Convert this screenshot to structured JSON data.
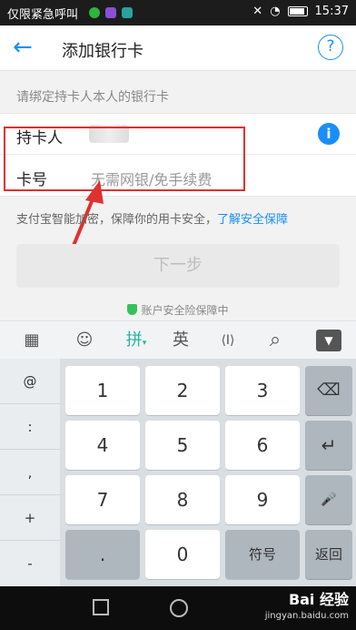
{
  "status_bar": {
    "carrier": "仅限紧急呼叫",
    "time": "15:37",
    "icons": [
      "wechat-icon",
      "app-icon",
      "app-icon",
      "mute-icon",
      "wifi-icon",
      "battery-icon"
    ]
  },
  "header": {
    "back_icon": "arrow-left-icon",
    "title": "添加银行卡",
    "help_label": "?"
  },
  "hint": "请绑定持卡人本人的银行卡",
  "form": {
    "holder_label": "持卡人",
    "info_label": "i",
    "card_label": "卡号",
    "card_placeholder": "无需网银/免手续费"
  },
  "notice": {
    "text": "支付宝智能加密，保障你的用卡安全，",
    "link": "了解安全保障"
  },
  "next_button": "下一步",
  "safety_text": "账户安全险保障中",
  "keyboard": {
    "toolbar": {
      "grid": "▦",
      "emoji": "☺",
      "pinyin": "拼",
      "english": "英",
      "cursor": "⟨I⟩",
      "search": "⌕",
      "collapse": "▼"
    },
    "side_keys": [
      "@",
      ":",
      ",",
      "+",
      "-"
    ],
    "digits": [
      "1",
      "2",
      "3",
      "4",
      "5",
      "6",
      "7",
      "8",
      "9"
    ],
    "dot": ".",
    "zero": "0",
    "symbol": "符号",
    "return": "返回",
    "delete_icon": "⌫",
    "enter_icon": "↵",
    "mic_icon": "🎤"
  },
  "watermark": {
    "brand": "Bai 经验",
    "url": "jingyan.baidu.com"
  },
  "colors": {
    "accent": "#1a8ef7",
    "highlight_box": "#e03030",
    "pinyin": "#28b3a4"
  }
}
